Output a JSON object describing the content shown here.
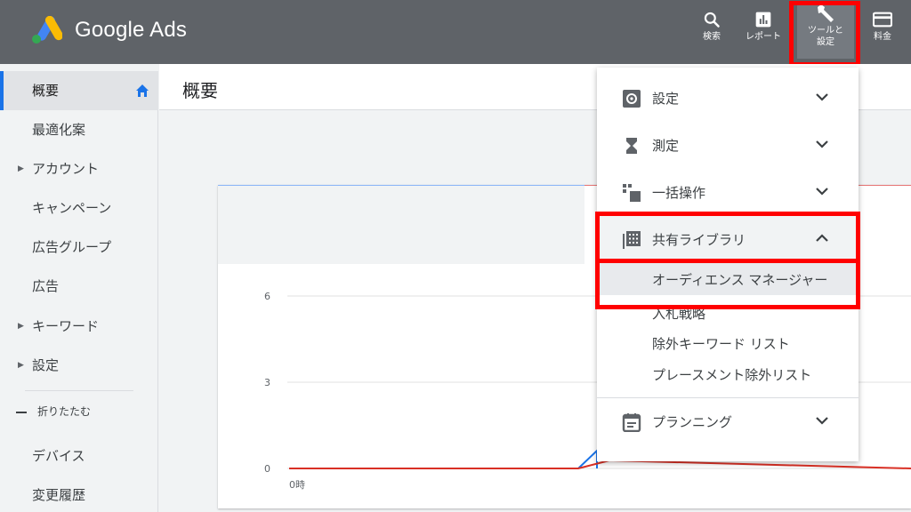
{
  "app": {
    "brand": "Google Ads"
  },
  "topbar": {
    "search_label": "検索",
    "report_label": "レポート",
    "tools_label_line1": "ツールと",
    "tools_label_line2": "設定",
    "billing_label": "料金"
  },
  "sidebar": {
    "items": [
      {
        "label": "概要",
        "active": true
      },
      {
        "label": "最適化案"
      },
      {
        "label": "アカウント",
        "expandable": true
      },
      {
        "label": "キャンペーン"
      },
      {
        "label": "広告グループ"
      },
      {
        "label": "広告"
      },
      {
        "label": "キーワード",
        "expandable": true
      },
      {
        "label": "設定",
        "expandable": true
      }
    ],
    "section_label": "折りたたむ",
    "extra_items": [
      {
        "label": "デバイス"
      },
      {
        "label": "変更履歴"
      }
    ]
  },
  "main": {
    "title": "概要",
    "chart": {
      "y_ticks": [
        "6",
        "3",
        "0"
      ],
      "x_tick": "0時"
    }
  },
  "chart_data": {
    "type": "line",
    "x": [
      "0時"
    ],
    "yticks": [
      0,
      3,
      6
    ],
    "ylim": [
      0,
      6
    ],
    "series": [
      {
        "color": "#d93025"
      },
      {
        "color": "#1a73e8"
      }
    ]
  },
  "tools_menu": {
    "sections": [
      {
        "label": "設定",
        "icon": "gear-icon",
        "expanded": false
      },
      {
        "label": "測定",
        "icon": "hourglass-icon",
        "expanded": false
      },
      {
        "label": "一括操作",
        "icon": "copy-icon",
        "expanded": false
      },
      {
        "label": "共有ライブラリ",
        "icon": "library-icon",
        "expanded": true
      },
      {
        "label": "プランニング",
        "icon": "calendar-icon",
        "expanded": false
      }
    ],
    "library_items": [
      "オーディエンス マネージャー",
      "入札戦略",
      "除外キーワード リスト",
      "プレースメント除外リスト"
    ]
  },
  "colors": {
    "topbar": "#5f6368",
    "accent": "#1a73e8",
    "highlight": "#ff0000"
  }
}
